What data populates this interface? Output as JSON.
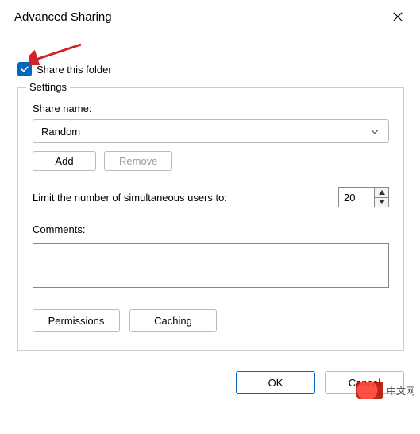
{
  "title": "Advanced Sharing",
  "share_checkbox_label": "Share this folder",
  "settings": {
    "legend": "Settings",
    "share_name_label": "Share name:",
    "share_name_value": "Random",
    "add_label": "Add",
    "remove_label": "Remove",
    "limit_label": "Limit the number of simultaneous users to:",
    "limit_value": "20",
    "comments_label": "Comments:",
    "comments_value": "",
    "permissions_label": "Permissions",
    "caching_label": "Caching"
  },
  "footer": {
    "ok": "OK",
    "cancel": "Cancel"
  },
  "watermark": "中文网"
}
